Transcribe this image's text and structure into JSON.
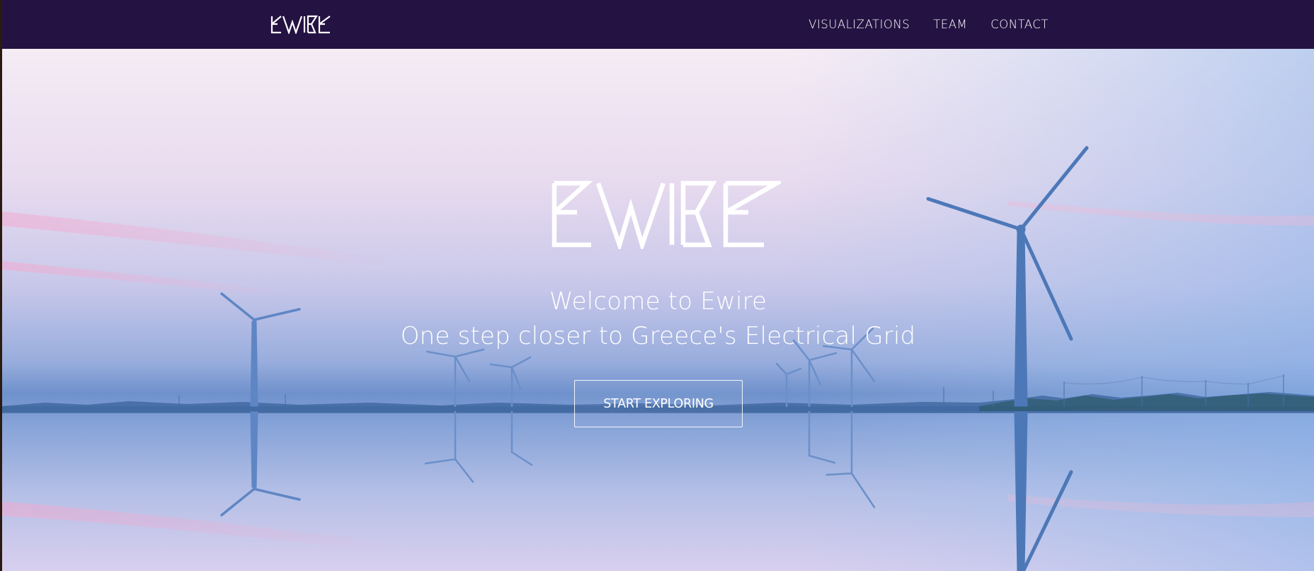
{
  "brand": {
    "name": "EWIRE",
    "colors": {
      "navbar": "#231242",
      "text": "#ffffff",
      "sky_top": "#f3e6f2",
      "sky_mid": "#b3c6ea",
      "horizon": "#5f88c6"
    }
  },
  "nav": {
    "logo_icon": "ewire-logo-icon",
    "links": [
      {
        "label": "VISUALIZATIONS"
      },
      {
        "label": "TEAM"
      },
      {
        "label": "CONTACT"
      }
    ]
  },
  "hero": {
    "background": "wind-turbines-reflection-image",
    "logo_icon": "ewire-logo-icon",
    "welcome": "Welcome to Ewire",
    "tagline": "One step closer to Greece's Electrical Grid",
    "cta_label": "START EXPLORING"
  }
}
